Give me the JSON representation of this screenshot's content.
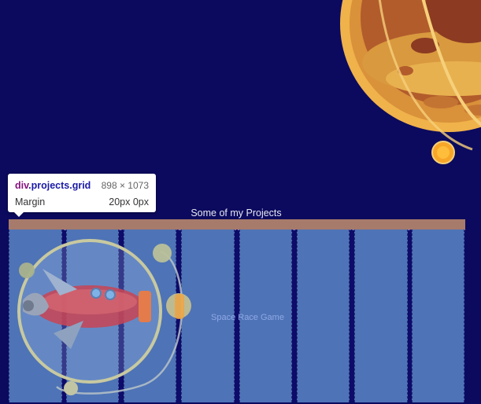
{
  "devtools": {
    "tooltip": {
      "element_tag": "div",
      "element_classes": ".projects.grid",
      "dimensions": "898 × 1073",
      "property_label": "Margin",
      "property_value": "20px 0px"
    }
  },
  "projects": {
    "heading": "Some of my Projects",
    "items": [
      {
        "label": "Space Race Game"
      }
    ]
  },
  "icons": {
    "planet": "planet-illustration",
    "rocket": "rocket-ship-illustration"
  },
  "colors": {
    "page_background": "#0b0a5e",
    "grid_column_overlay": "#4e73b6",
    "margin_overlay": "#a77b6b",
    "planet_orange": "#f0a93a"
  }
}
